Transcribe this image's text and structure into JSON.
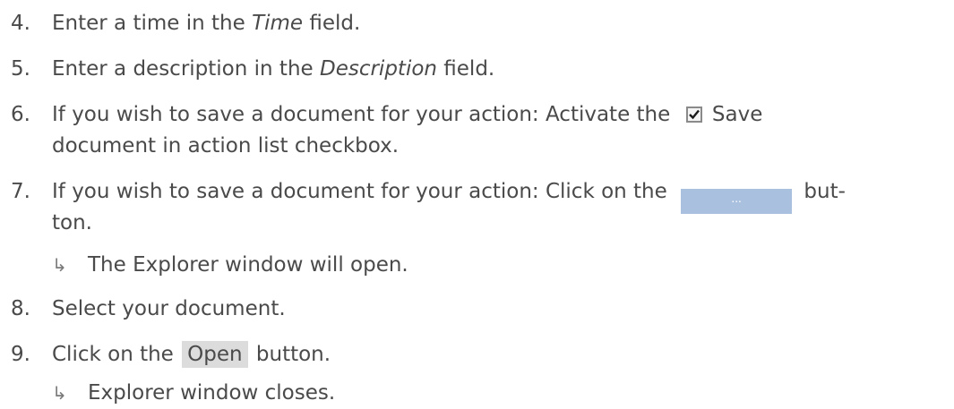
{
  "steps": [
    {
      "num": "4.",
      "pre": "Enter a time in the ",
      "em": "Time",
      "post": " field."
    },
    {
      "num": "5.",
      "pre": "Enter a description in the ",
      "em": "Description",
      "post": " field."
    },
    {
      "num": "6.",
      "pre": "If you wish to save a document for your action: Activate the ",
      "post": " Save",
      "line2": "document in action list checkbox."
    },
    {
      "num": "7.",
      "pre": "If you wish to save a document for your action: Click on the ",
      "button": "...",
      "post": " but-",
      "line2": "ton.",
      "result": "The Explorer window will open."
    },
    {
      "num": "8.",
      "pre": "Select your document."
    },
    {
      "num": "9.",
      "pre": "Click on the ",
      "button": "Open",
      "post": " button.",
      "result": "Explorer window closes."
    }
  ],
  "result_marker": "↳",
  "icons": {
    "checkbox": "checked-checkbox-icon",
    "arrow": "result-arrow-icon"
  }
}
